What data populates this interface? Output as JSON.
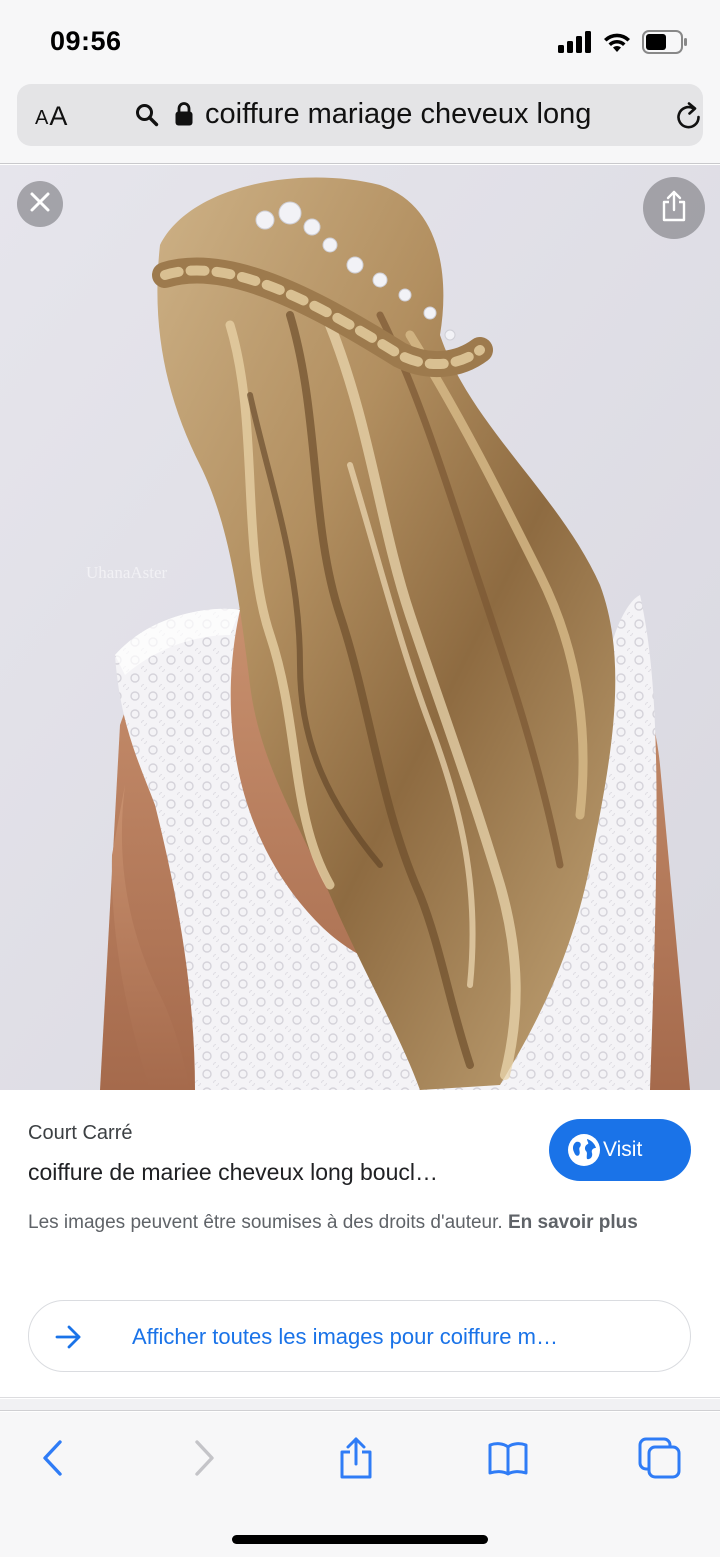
{
  "status_bar": {
    "time": "09:56",
    "icons": [
      "cellular-signal-icon",
      "wifi-icon",
      "battery-icon"
    ]
  },
  "address_bar": {
    "aa_small": "A",
    "aa_large": "A",
    "url_text": "coiffure mariage cheveux long",
    "icons": [
      "search-icon",
      "lock-icon",
      "reload-icon"
    ]
  },
  "image_viewer": {
    "watermark": "UhanaAster",
    "icons": [
      "close-icon",
      "share-icon"
    ]
  },
  "result": {
    "source": "Court Carré",
    "title": "coiffure de mariee cheveux long boucl…",
    "visit_label": "Visit",
    "copyright_text": "Les images peuvent être soumises à des droits d'auteur. ",
    "learn_more": "En savoir plus",
    "see_all_label": "Afficher toutes les images pour coiffure m…"
  },
  "toolbar": {
    "icons": [
      "back-icon",
      "forward-icon",
      "share-icon",
      "bookmarks-icon",
      "tabs-icon"
    ]
  },
  "colors": {
    "accent": "#1a73e8",
    "toolbar_icon": "#2f7cf6",
    "disabled_icon": "#c4c4c8"
  }
}
